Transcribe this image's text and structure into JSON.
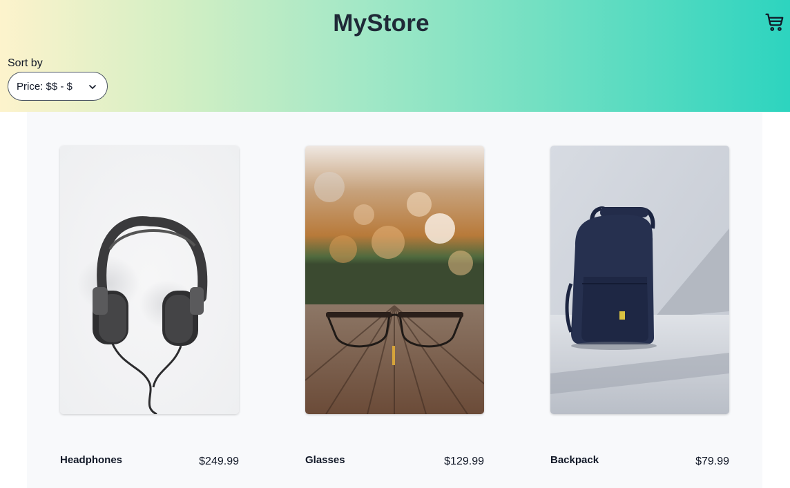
{
  "header": {
    "title": "MyStore",
    "cart_icon": "shopping-cart-icon"
  },
  "sort": {
    "label": "Sort by",
    "selected": "Price: $$ - $",
    "icon": "chevron-down-icon"
  },
  "products": [
    {
      "name": "Headphones",
      "price": "$249.99",
      "image": "headphones-photo"
    },
    {
      "name": "Glasses",
      "price": "$129.99",
      "image": "glasses-photo"
    },
    {
      "name": "Backpack",
      "price": "$79.99",
      "image": "backpack-photo"
    }
  ],
  "colors": {
    "gradient_start": "#fdf3cc",
    "gradient_end": "#2dd4bf",
    "content_bg": "#f8f9fb",
    "text": "#111827"
  }
}
